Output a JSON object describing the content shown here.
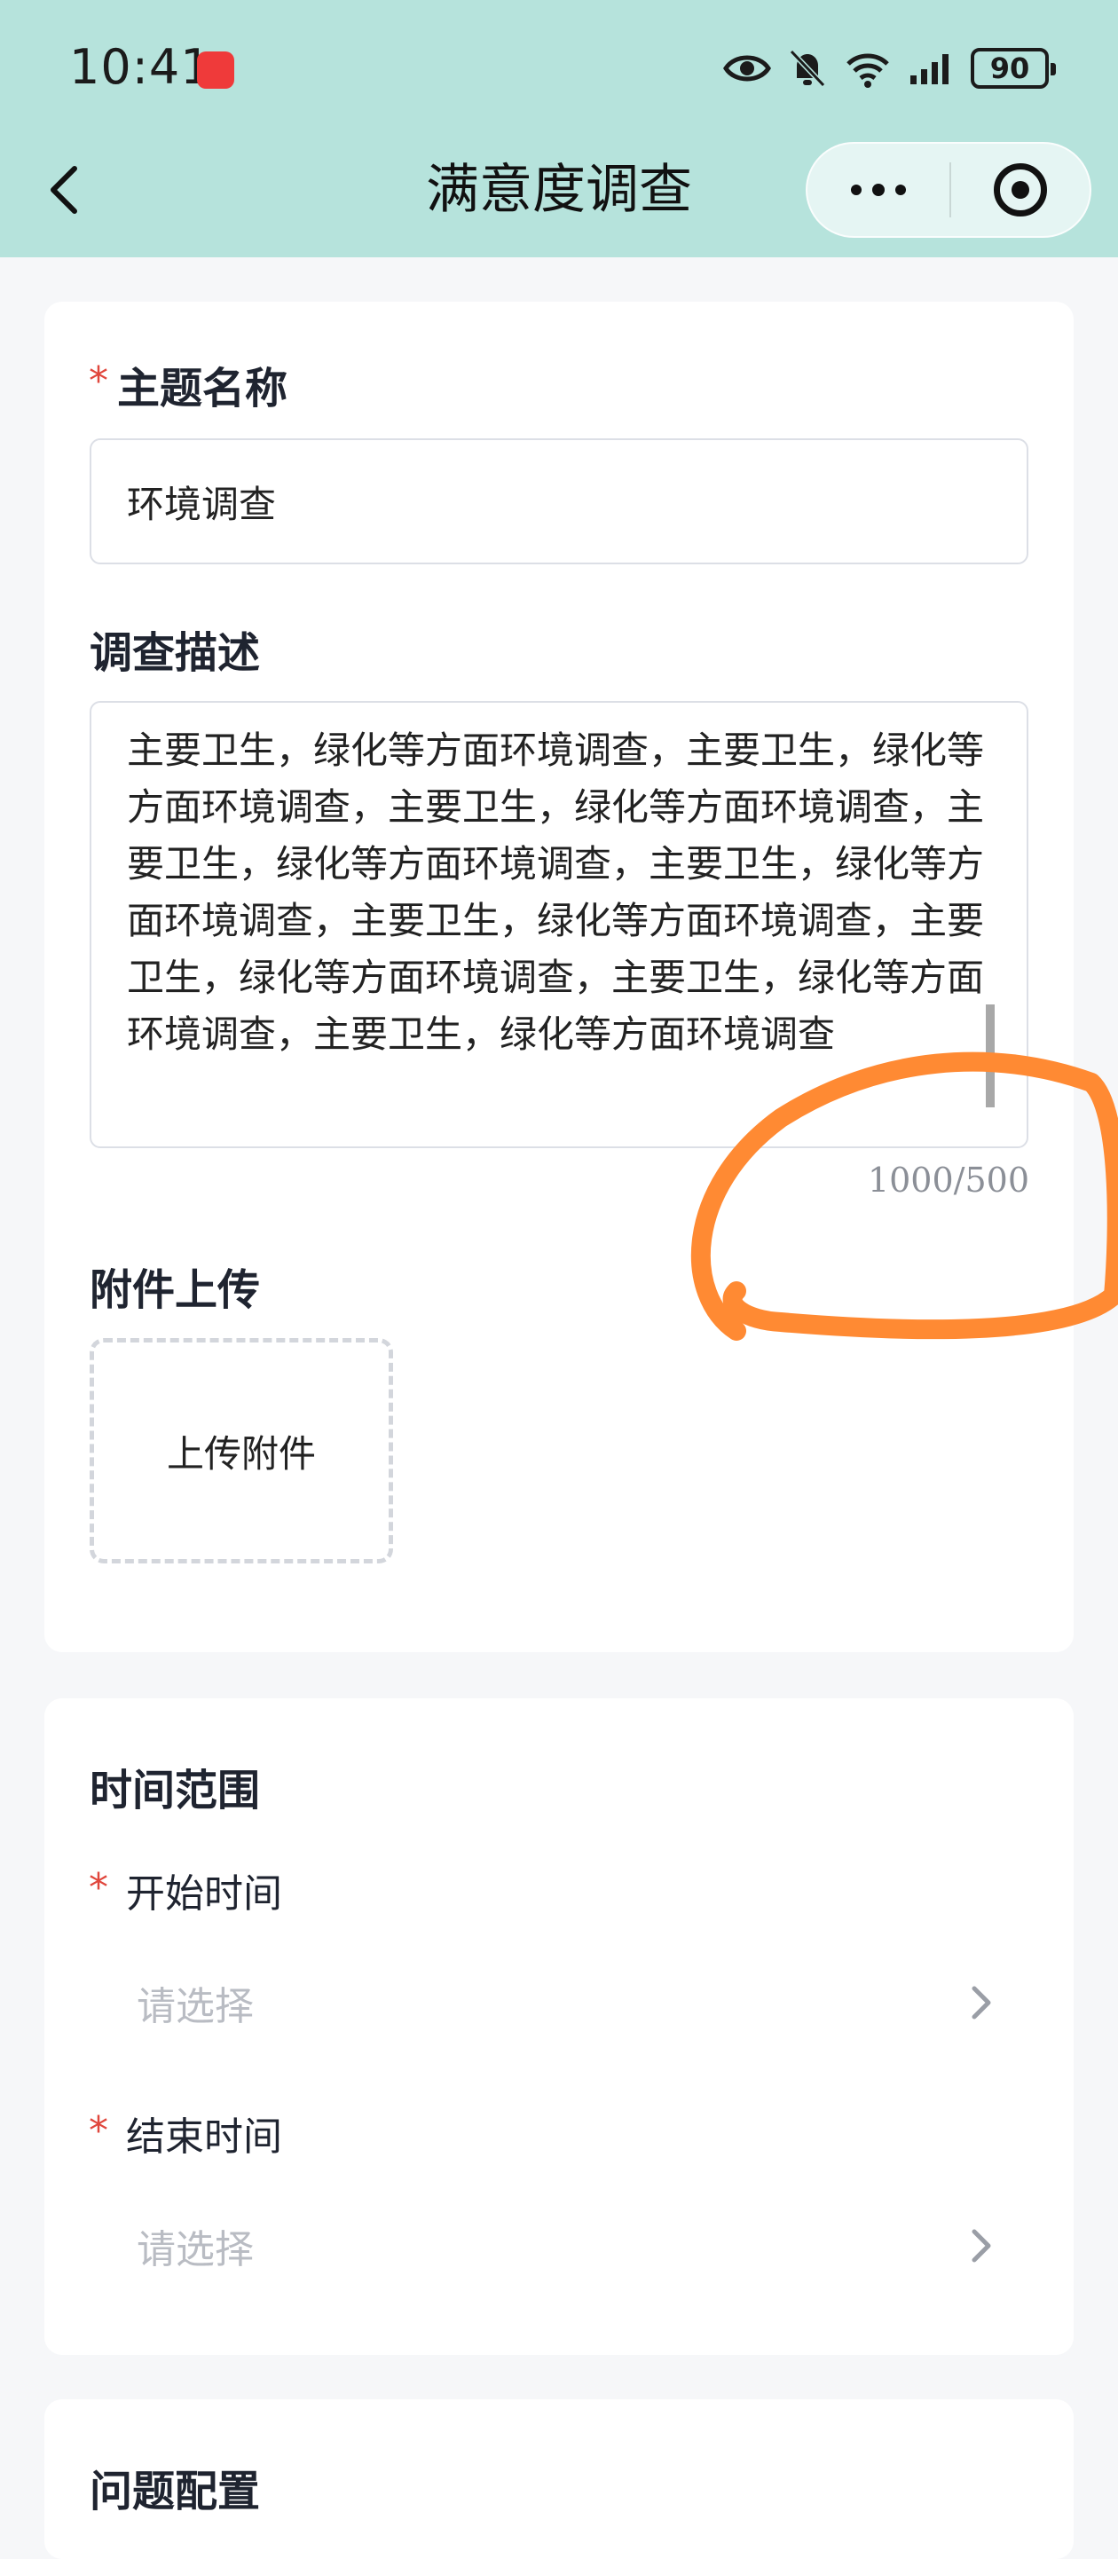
{
  "status_bar": {
    "time": "10:41",
    "battery": "90",
    "icons": [
      "eye-icon",
      "bell-off-icon",
      "wifi-icon",
      "signal-icon",
      "battery-icon"
    ]
  },
  "nav": {
    "title": "满意度调查",
    "back_icon": "chevron-left-icon",
    "more_icon": "more-dots-icon",
    "close_icon": "target-close-icon"
  },
  "form": {
    "subject": {
      "required_mark": "*",
      "label": "主题名称",
      "value": "环境调查"
    },
    "description": {
      "label": "调查描述",
      "value": "主要卫生，绿化等方面环境调查，主要卫生，绿化等方面环境调查，主要卫生，绿化等方面环境调查，主要卫生，绿化等方面环境调查，主要卫生，绿化等方面环境调查，主要卫生，绿化等方面环境调查，主要卫生，绿化等方面环境调查，主要卫生，绿化等方面环境调查，主要卫生，绿化等方面环境调查",
      "counter": "1000/500"
    },
    "attachment": {
      "label": "附件上传",
      "button": "上传附件"
    }
  },
  "time_range": {
    "title": "时间范围",
    "start": {
      "required_mark": "*",
      "label": "开始时间",
      "placeholder": "请选择"
    },
    "end": {
      "required_mark": "*",
      "label": "结束时间",
      "placeholder": "请选择"
    }
  },
  "question_config": {
    "title": "问题配置"
  },
  "colors": {
    "header_bg": "#b6e3dc",
    "required": "#e0463c",
    "annotation": "#ff8a33"
  }
}
